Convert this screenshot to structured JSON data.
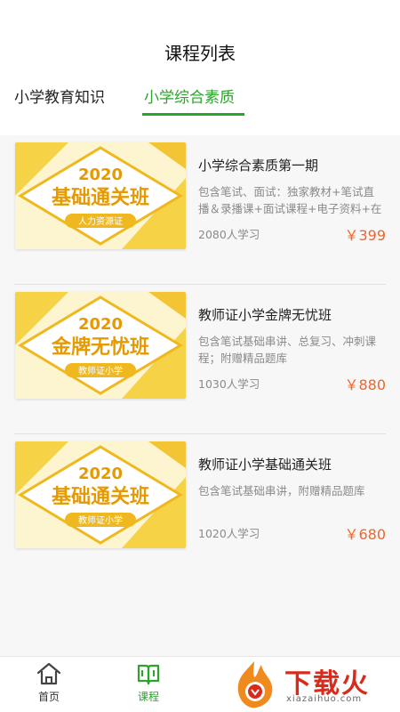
{
  "header": {
    "title": "课程列表"
  },
  "tabs": [
    {
      "label": "小学教育知识",
      "active": false
    },
    {
      "label": "小学综合素质",
      "active": true
    }
  ],
  "accent_color": "#2aa52a",
  "price_color": "#f0652a",
  "courses": [
    {
      "thumb_year": "2020",
      "thumb_title": "基础通关班",
      "thumb_badge": "人力资源证",
      "title": "小学综合素质第一期",
      "desc": "包含笔试、面试：独家教材+笔试直播＆录播课+面试课程+电子资料+在线...",
      "learners": "2080人学习",
      "price": "￥399"
    },
    {
      "thumb_year": "2020",
      "thumb_title": "金牌无忧班",
      "thumb_badge": "教师证小学",
      "title": "教师证小学金牌无忧班",
      "desc": "包含笔试基础串讲、总复习、冲刺课程；附赠精品题库",
      "learners": "1030人学习",
      "price": "￥880"
    },
    {
      "thumb_year": "2020",
      "thumb_title": "基础通关班",
      "thumb_badge": "教师证小学",
      "title": "教师证小学基础通关班",
      "desc": "包含笔试基础串讲，附赠精品题库",
      "learners": "1020人学习",
      "price": "￥680"
    }
  ],
  "bottom_nav": [
    {
      "label": "首页",
      "icon": "home-icon",
      "active": false
    },
    {
      "label": "课程",
      "icon": "book-icon",
      "active": true
    }
  ],
  "watermark": {
    "text": "下载火",
    "sub": "xiazaihuo.com"
  }
}
